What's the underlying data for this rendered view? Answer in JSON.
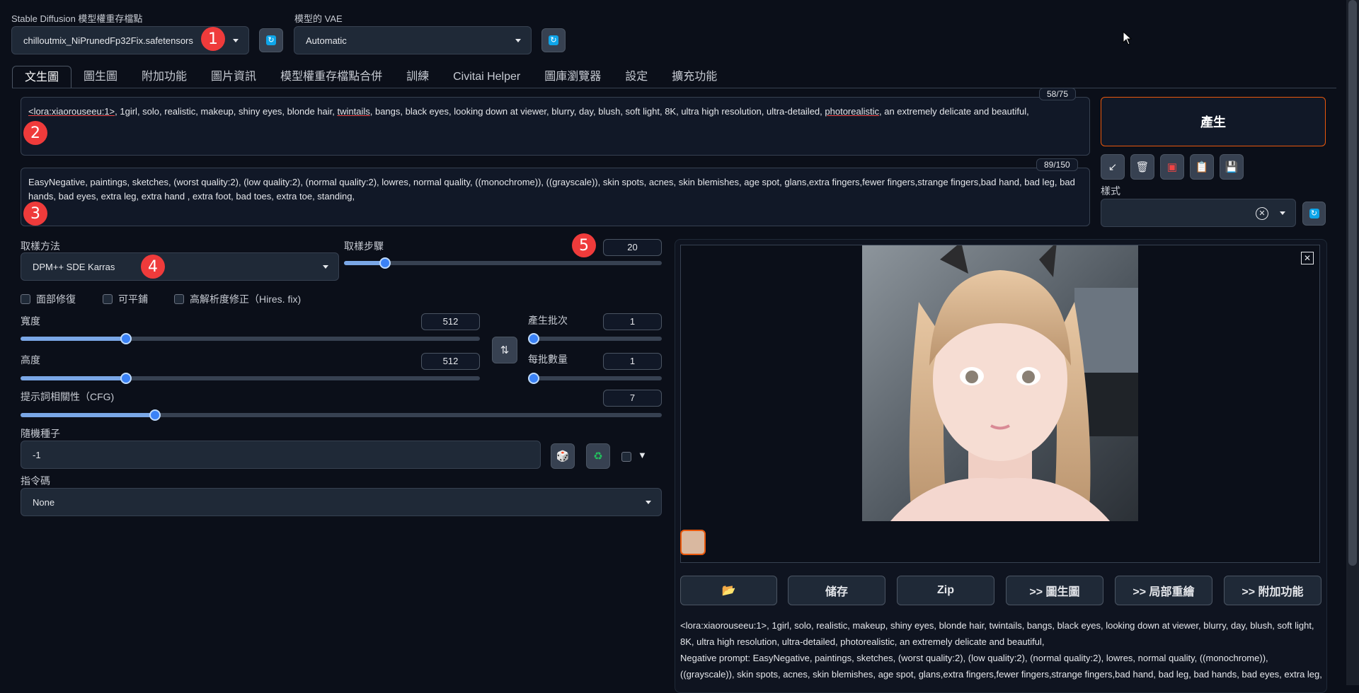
{
  "top": {
    "checkpoint_label": "Stable Diffusion 模型權重存檔點",
    "checkpoint_value": "chilloutmix_NiPrunedFp32Fix.safetensors",
    "vae_label": "模型的 VAE",
    "vae_value": "Automatic"
  },
  "tabs": [
    "文生圖",
    "圖生圖",
    "附加功能",
    "圖片資訊",
    "模型權重存檔點合併",
    "訓練",
    "Civitai Helper",
    "圖庫瀏覽器",
    "設定",
    "擴充功能"
  ],
  "prompt": {
    "counter": "58/75",
    "p1": "<lora:xiaorouseeu:1>",
    "p2": ", 1girl, solo, realistic, makeup, shiny eyes, blonde hair, ",
    "p3": "twintails",
    "p4": ", bangs, black eyes, looking down at viewer, blurry, day, blush, soft light, 8K, ultra high resolution, ultra-detailed, ",
    "p5": "photorealistic",
    "p6": ", an extremely delicate and beautiful,"
  },
  "negative": {
    "counter": "89/150",
    "text": "EasyNegative, paintings, sketches, (worst quality:2), (low quality:2), (normal quality:2), lowres, normal quality, ((monochrome)), ((grayscale)), skin spots, acnes, skin blemishes, age spot, glans,extra fingers,fewer fingers,strange fingers,bad hand, bad leg, bad hands, bad eyes, extra leg, extra hand , extra foot, bad toes, extra toe, standing,"
  },
  "generate_label": "產生",
  "style_label": "樣式",
  "sampler": {
    "label": "取樣方法",
    "value": "DPM++ SDE Karras"
  },
  "steps": {
    "label": "取樣步驟",
    "value": "20",
    "fraction": 0.13
  },
  "checks": {
    "face": "面部修復",
    "tiling": "可平鋪",
    "hires": "高解析度修正（Hires. fix)"
  },
  "width": {
    "label": "寬度",
    "value": "512",
    "fraction": 0.23
  },
  "height": {
    "label": "高度",
    "value": "512",
    "fraction": 0.23
  },
  "batch_count": {
    "label": "產生批次",
    "value": "1",
    "fraction": 0.0
  },
  "batch_size": {
    "label": "每批數量",
    "value": "1",
    "fraction": 0.0
  },
  "cfg": {
    "label": "提示詞相關性（CFG)",
    "value": "7",
    "fraction": 0.21
  },
  "seed": {
    "label": "隨機種子",
    "value": "-1"
  },
  "script": {
    "label": "指令碼",
    "value": "None"
  },
  "actions": [
    "储存",
    "Zip",
    ">> 圖生圖",
    ">> 局部重繪",
    ">> 附加功能"
  ],
  "info": {
    "line1": "<lora:xiaorouseeu:1>, 1girl, solo, realistic, makeup, shiny eyes, blonde hair, twintails, bangs, black eyes, looking down at viewer, blurry, day, blush, soft light,",
    "line2": "8K, ultra high resolution, ultra-detailed, photorealistic, an extremely delicate and beautiful,",
    "line3": "Negative prompt: EasyNegative, paintings, sketches, (worst quality:2), (low quality:2), (normal quality:2), lowres, normal quality, ((monochrome)),",
    "line4": "((grayscale)), skin spots, acnes, skin blemishes, age spot, glans,extra fingers,fewer fingers,strange fingers,bad hand, bad leg, bad hands, bad eyes, extra leg,"
  },
  "badges": [
    "1",
    "2",
    "3",
    "4",
    "5"
  ]
}
